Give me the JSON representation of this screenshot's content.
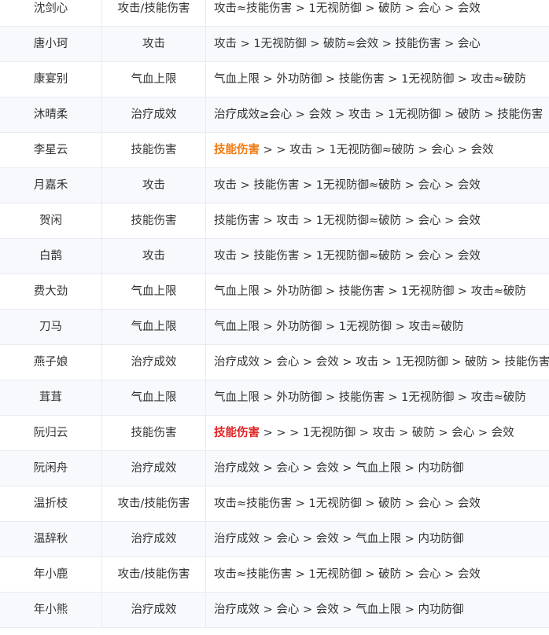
{
  "colors": {
    "highlight_orange": "#f07a12",
    "highlight_red": "#e02424",
    "row_alt_bg": "#f7f9fc",
    "border": "#e8ebf0"
  },
  "rows": [
    {
      "name": "沈剑心",
      "type": "攻击/技能伤害",
      "highlight": "",
      "priority": "攻击≈技能伤害 > 1无视防御 > 破防 > 会心 > 会效"
    },
    {
      "name": "唐小珂",
      "type": "攻击",
      "highlight": "",
      "priority": "攻击 > 1无视防御 > 破防≈会效 > 技能伤害 > 会心"
    },
    {
      "name": "康宴别",
      "type": "气血上限",
      "highlight": "",
      "priority": "气血上限 > 外功防御 > 技能伤害 > 1无视防御 > 攻击≈破防"
    },
    {
      "name": "沐晴柔",
      "type": "治疗成效",
      "highlight": "",
      "priority": "治疗成效≥会心 > 会效 > 攻击 > 1无视防御 > 破防 > 技能伤害"
    },
    {
      "name": "李星云",
      "type": "技能伤害",
      "highlight": "技能伤害",
      "priority": " > > 攻击 > 1无视防御≈破防 > 会心 > 会效"
    },
    {
      "name": "月嘉禾",
      "type": "攻击",
      "highlight": "",
      "priority": "攻击 > 技能伤害 > 1无视防御≈破防 > 会心 > 会效"
    },
    {
      "name": "贺闲",
      "type": "技能伤害",
      "highlight": "",
      "priority": "技能伤害 > 攻击 > 1无视防御≈破防 > 会心 > 会效"
    },
    {
      "name": "白鹊",
      "type": "攻击",
      "highlight": "",
      "priority": "攻击 > 技能伤害 > 1无视防御≈破防 > 会心 > 会效"
    },
    {
      "name": "费大劲",
      "type": "气血上限",
      "highlight": "",
      "priority": "气血上限 > 外功防御 > 技能伤害 > 1无视防御 > 攻击≈破防"
    },
    {
      "name": "刀马",
      "type": "气血上限",
      "highlight": "",
      "priority": "气血上限 > 外功防御 > 1无视防御 > 攻击≈破防"
    },
    {
      "name": "燕子娘",
      "type": "治疗成效",
      "highlight": "",
      "priority": "治疗成效 > 会心 > 会效 > 攻击 > 1无视防御 > 破防 > 技能伤害"
    },
    {
      "name": "茸茸",
      "type": "气血上限",
      "highlight": "",
      "priority": "气血上限 > 外功防御 > 技能伤害 > 1无视防御 > 攻击≈破防"
    },
    {
      "name": "阮归云",
      "type": "技能伤害",
      "highlight": "技能伤害",
      "priority": " > > > 1无视防御 > 攻击 > 破防 > 会心 > 会效"
    },
    {
      "name": "阮闲舟",
      "type": "治疗成效",
      "highlight": "",
      "priority": "治疗成效 > 会心 > 会效 > 气血上限 > 内功防御"
    },
    {
      "name": "温折枝",
      "type": "攻击/技能伤害",
      "highlight": "",
      "priority": "攻击≈技能伤害 > 1无视防御 > 破防 > 会心 > 会效"
    },
    {
      "name": "温辞秋",
      "type": "治疗成效",
      "highlight": "",
      "priority": "治疗成效 > 会心 > 会效 > 气血上限 > 内功防御"
    },
    {
      "name": "年小鹿",
      "type": "攻击/技能伤害",
      "highlight": "",
      "priority": "攻击≈技能伤害 > 1无视防御 > 破防 > 会心 > 会效"
    },
    {
      "name": "年小熊",
      "type": "治疗成效",
      "highlight": "",
      "priority": "治疗成效 > 会心 > 会效 > 气血上限 > 内功防御"
    }
  ]
}
